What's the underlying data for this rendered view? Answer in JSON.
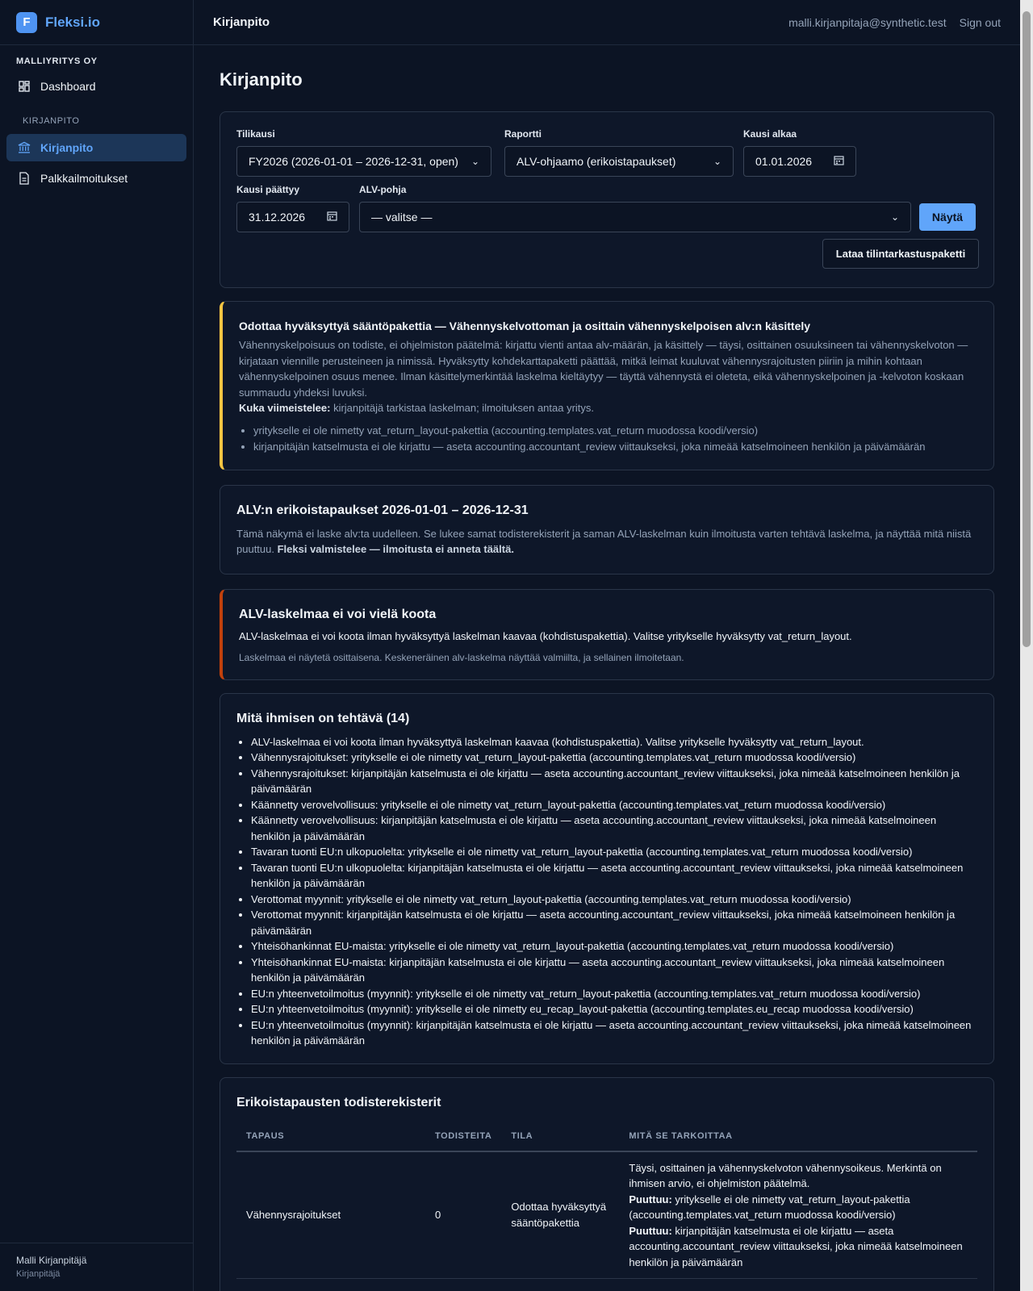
{
  "brand": {
    "logo_letter": "F",
    "name": "Fleksi.io"
  },
  "sidebar": {
    "company": "MALLIYRITYS OY",
    "dashboard": "Dashboard",
    "section": "KIRJANPITO",
    "items": [
      {
        "label": "Kirjanpito",
        "icon": "bank-icon",
        "active": true
      },
      {
        "label": "Palkkailmoitukset",
        "icon": "document-icon",
        "active": false
      }
    ],
    "user": {
      "name": "Malli Kirjanpitäjä",
      "role": "Kirjanpitäjä"
    }
  },
  "topbar": {
    "title": "Kirjanpito",
    "email": "malli.kirjanpitaja@synthetic.test",
    "signout": "Sign out"
  },
  "page": {
    "title": "Kirjanpito"
  },
  "filters": {
    "fiscal_label": "Tilikausi",
    "fiscal_value": "FY2026 (2026-01-01 – 2026-12-31, open)",
    "report_label": "Raportti",
    "report_value": "ALV-ohjaamo (erikoistapaukset)",
    "start_label": "Kausi alkaa",
    "start_value": "01.01.2026",
    "end_label": "Kausi päättyy",
    "end_value": "31.12.2026",
    "template_label": "ALV-pohja",
    "template_value": "— valitse —",
    "show_button": "Näytä",
    "download_button": "Lataa tilintarkastuspaketti"
  },
  "warning": {
    "title": "Odottaa hyväksyttyä sääntöpakettia — Vähennyskelvottoman ja osittain vähennyskelpoisen alv:n käsittely",
    "body": "Vähennyskelpoisuus on todiste, ei ohjelmiston päätelmä: kirjattu vienti antaa alv-määrän, ja käsittely — täysi, osittainen osuuksineen tai vähennyskelvoton — kirjataan viennille perusteineen ja nimissä. Hyväksytty kohdekarttapaketti päättää, mitkä leimat kuuluvat vähennysrajoitusten piiriin ja mihin kohtaan vähennyskelpoinen osuus menee. Ilman käsittelymerkintää laskelma kieltäytyy — täyttä vähennystä ei oleteta, eikä vähennyskelpoinen ja -kelvoton koskaan summaudu yhdeksi luvuksi.",
    "who_label": "Kuka viimeistelee:",
    "who_text": " kirjanpitäjä tarkistaa laskelman; ilmoituksen antaa yritys.",
    "items": [
      "yritykselle ei ole nimetty vat_return_layout-pakettia (accounting.templates.vat_return muodossa koodi/versio)",
      "kirjanpitäjän katselmusta ei ole kirjattu — aseta accounting.accountant_review viittaukseksi, joka nimeää katselmoineen henkilön ja päivämäärän"
    ]
  },
  "info": {
    "title": "ALV:n erikoistapaukset 2026-01-01 – 2026-12-31",
    "body": "Tämä näkymä ei laske alv:ta uudelleen. Se lukee samat todisterekisterit ja saman ALV-laskelman kuin ilmoitusta varten tehtävä laskelma, ja näyttää mitä niistä puuttuu. ",
    "bold": "Fleksi valmistelee — ilmoitusta ei anneta täältä."
  },
  "error": {
    "title": "ALV-laskelmaa ei voi vielä koota",
    "message": "ALV-laskelmaa ei voi koota ilman hyväksyttyä laskelman kaavaa (kohdistuspakettia). Valitse yritykselle hyväksytty vat_return_layout.",
    "note": "Laskelmaa ei näytetä osittaisena. Keskeneräinen alv-laskelma näyttää valmiilta, ja sellainen ilmoitetaan."
  },
  "todo": {
    "title": "Mitä ihmisen on tehtävä (14)",
    "items": [
      "ALV-laskelmaa ei voi koota ilman hyväksyttyä laskelman kaavaa (kohdistuspakettia). Valitse yritykselle hyväksytty vat_return_layout.",
      "Vähennysrajoitukset: yritykselle ei ole nimetty vat_return_layout-pakettia (accounting.templates.vat_return muodossa koodi/versio)",
      "Vähennysrajoitukset: kirjanpitäjän katselmusta ei ole kirjattu — aseta accounting.accountant_review viittaukseksi, joka nimeää katselmoineen henkilön ja päivämäärän",
      "Käännetty verovelvollisuus: yritykselle ei ole nimetty vat_return_layout-pakettia (accounting.templates.vat_return muodossa koodi/versio)",
      "Käännetty verovelvollisuus: kirjanpitäjän katselmusta ei ole kirjattu — aseta accounting.accountant_review viittaukseksi, joka nimeää katselmoineen henkilön ja päivämäärän",
      "Tavaran tuonti EU:n ulkopuolelta: yritykselle ei ole nimetty vat_return_layout-pakettia (accounting.templates.vat_return muodossa koodi/versio)",
      "Tavaran tuonti EU:n ulkopuolelta: kirjanpitäjän katselmusta ei ole kirjattu — aseta accounting.accountant_review viittaukseksi, joka nimeää katselmoineen henkilön ja päivämäärän",
      "Verottomat myynnit: yritykselle ei ole nimetty vat_return_layout-pakettia (accounting.templates.vat_return muodossa koodi/versio)",
      "Verottomat myynnit: kirjanpitäjän katselmusta ei ole kirjattu — aseta accounting.accountant_review viittaukseksi, joka nimeää katselmoineen henkilön ja päivämäärän",
      "Yhteisöhankinnat EU-maista: yritykselle ei ole nimetty vat_return_layout-pakettia (accounting.templates.vat_return muodossa koodi/versio)",
      "Yhteisöhankinnat EU-maista: kirjanpitäjän katselmusta ei ole kirjattu — aseta accounting.accountant_review viittaukseksi, joka nimeää katselmoineen henkilön ja päivämäärän",
      "EU:n yhteenvetoilmoitus (myynnit): yritykselle ei ole nimetty vat_return_layout-pakettia (accounting.templates.vat_return muodossa koodi/versio)",
      "EU:n yhteenvetoilmoitus (myynnit): yritykselle ei ole nimetty eu_recap_layout-pakettia (accounting.templates.eu_recap muodossa koodi/versio)",
      "EU:n yhteenvetoilmoitus (myynnit): kirjanpitäjän katselmusta ei ole kirjattu — aseta accounting.accountant_review viittaukseksi, joka nimeää katselmoineen henkilön ja päivämäärän"
    ]
  },
  "registers": {
    "title": "Erikoistapausten todisterekisterit",
    "headers": [
      "TAPAUS",
      "TODISTEITA",
      "TILA",
      "MITÄ SE TARKOITTAA"
    ],
    "rows": [
      {
        "case": "Vähennysrajoitukset",
        "count": "0",
        "status": "Odottaa hyväksyttyä sääntöpakettia",
        "meaning": "Täysi, osittainen ja vähennyskelvoton vähennysoikeus. Merkintä on ihmisen arvio, ei ohjelmiston päätelmä.",
        "missing_label": "Puuttuu:",
        "missing": [
          " yritykselle ei ole nimetty vat_return_layout-pakettia (accounting.templates.vat_return muodossa koodi/versio)",
          " kirjanpitäjän katselmusta ei ole kirjattu — aseta accounting.accountant_review viittaukseksi, joka nimeää katselmoineen henkilön ja päivämäärän"
        ]
      }
    ]
  },
  "colors": {
    "background": "#0c1424",
    "accent": "#60a5fa",
    "warning": "#f5c542",
    "error": "#c2410c"
  }
}
